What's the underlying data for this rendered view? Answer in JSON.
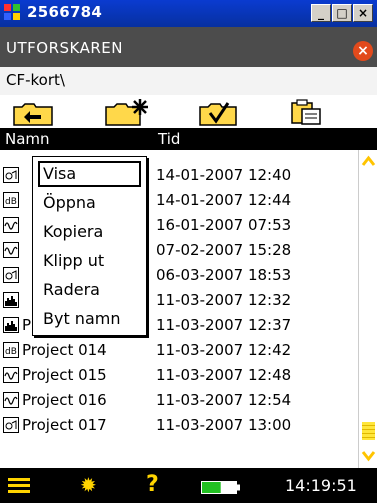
{
  "window": {
    "title": "2566784",
    "minimize_label": "_",
    "maximize_label": "□",
    "close_label": "×"
  },
  "header": {
    "title": "UTFORSKAREN",
    "close_label": "×"
  },
  "path": {
    "text": "CF-kort\\"
  },
  "toolbar": {
    "buttons": [
      {
        "icon": "folder-up-icon"
      },
      {
        "icon": "new-folder-icon"
      },
      {
        "icon": "select-icon"
      },
      {
        "icon": "paste-icon"
      }
    ]
  },
  "columns": {
    "name": "Namn",
    "time": "Tid"
  },
  "rows": [
    {
      "icon": "sound-file-icon",
      "name": "",
      "time": "14-01-2007 12:40"
    },
    {
      "icon": "db-file-icon",
      "name": "",
      "time": "14-01-2007 12:44"
    },
    {
      "icon": "wave-file-icon",
      "name": "",
      "time": "16-01-2007 07:53"
    },
    {
      "icon": "wave-file-icon",
      "name": "",
      "time": "07-02-2007 15:28"
    },
    {
      "icon": "sound-file-icon",
      "name": "",
      "time": "06-03-2007 18:53"
    },
    {
      "icon": "spectrum-file-icon",
      "name": "",
      "time": "11-03-2007 12:32"
    },
    {
      "icon": "spectrum-file-icon",
      "name": "Project 013",
      "time": "11-03-2007 12:37"
    },
    {
      "icon": "db-file-icon",
      "name": "Project 014",
      "time": "11-03-2007 12:42"
    },
    {
      "icon": "wave-file-icon",
      "name": "Project 015",
      "time": "11-03-2007 12:48"
    },
    {
      "icon": "wave-file-icon",
      "name": "Project 016",
      "time": "11-03-2007 12:54"
    },
    {
      "icon": "sound-file-icon",
      "name": "Project 017",
      "time": "11-03-2007 13:00"
    }
  ],
  "context_menu": {
    "items": [
      {
        "label": "Visa",
        "selected": true
      },
      {
        "label": "Öppna"
      },
      {
        "label": "Kopiera"
      },
      {
        "label": "Klipp ut"
      },
      {
        "label": "Radera"
      },
      {
        "label": "Byt namn"
      }
    ]
  },
  "taskbar": {
    "clock": "14:19:51",
    "help_label": "?",
    "battery_level": 0.55
  },
  "colors": {
    "title_blue": "#0a3bd0",
    "header_gray": "#4c4c4c",
    "accent_yellow": "#ffd400",
    "battery_green": "#22c122",
    "close_orange": "#e24a1c"
  }
}
